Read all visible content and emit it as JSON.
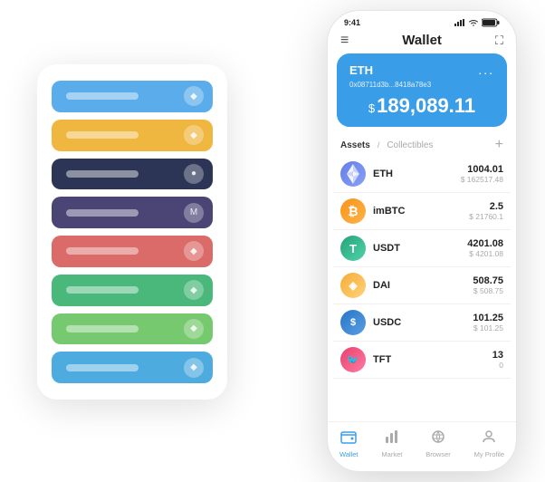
{
  "scene": {
    "back_panel": {
      "cards": [
        {
          "color": "#5aadea",
          "icon": "◆"
        },
        {
          "color": "#f0b740",
          "icon": "◆"
        },
        {
          "color": "#2d3556",
          "icon": "●"
        },
        {
          "color": "#4a4575",
          "icon": "M"
        },
        {
          "color": "#db6b68",
          "icon": "◆"
        },
        {
          "color": "#4ab87a",
          "icon": "◆"
        },
        {
          "color": "#76c96e",
          "icon": "◆"
        },
        {
          "color": "#4eabdf",
          "icon": "◆"
        }
      ]
    },
    "phone": {
      "status_bar": {
        "time": "9:41",
        "battery": "▌"
      },
      "header": {
        "menu_icon": "≡",
        "title": "Wallet",
        "expand_icon": "⛶"
      },
      "eth_card": {
        "name": "ETH",
        "address": "0x08711d3b...8418a78e3",
        "more": "...",
        "balance_symbol": "$",
        "balance": "189,089.11"
      },
      "assets": {
        "tab_active": "Assets",
        "separator": "/",
        "tab_inactive": "Collectibles",
        "add_icon": "+"
      },
      "asset_list": [
        {
          "symbol": "ETH",
          "name": "ETH",
          "logo_type": "eth",
          "logo_char": "♦",
          "amount": "1004.01",
          "usd": "$ 162517.48"
        },
        {
          "symbol": "imBTC",
          "name": "imBTC",
          "logo_type": "imbtc",
          "logo_char": "₿",
          "amount": "2.5",
          "usd": "$ 21760.1"
        },
        {
          "symbol": "USDT",
          "name": "USDT",
          "logo_type": "usdt",
          "logo_char": "T",
          "amount": "4201.08",
          "usd": "$ 4201.08"
        },
        {
          "symbol": "DAI",
          "name": "DAI",
          "logo_type": "dai",
          "logo_char": "◈",
          "amount": "508.75",
          "usd": "$ 508.75"
        },
        {
          "symbol": "USDC",
          "name": "USDC",
          "logo_type": "usdc",
          "logo_char": "$",
          "amount": "101.25",
          "usd": "$ 101.25"
        },
        {
          "symbol": "TFT",
          "name": "TFT",
          "logo_type": "tft",
          "logo_char": "🐦",
          "amount": "13",
          "usd": "0"
        }
      ],
      "bottom_nav": [
        {
          "label": "Wallet",
          "icon": "◎",
          "active": true
        },
        {
          "label": "Market",
          "icon": "📊",
          "active": false
        },
        {
          "label": "Browser",
          "icon": "⊙",
          "active": false
        },
        {
          "label": "My Profile",
          "icon": "👤",
          "active": false
        }
      ]
    }
  }
}
